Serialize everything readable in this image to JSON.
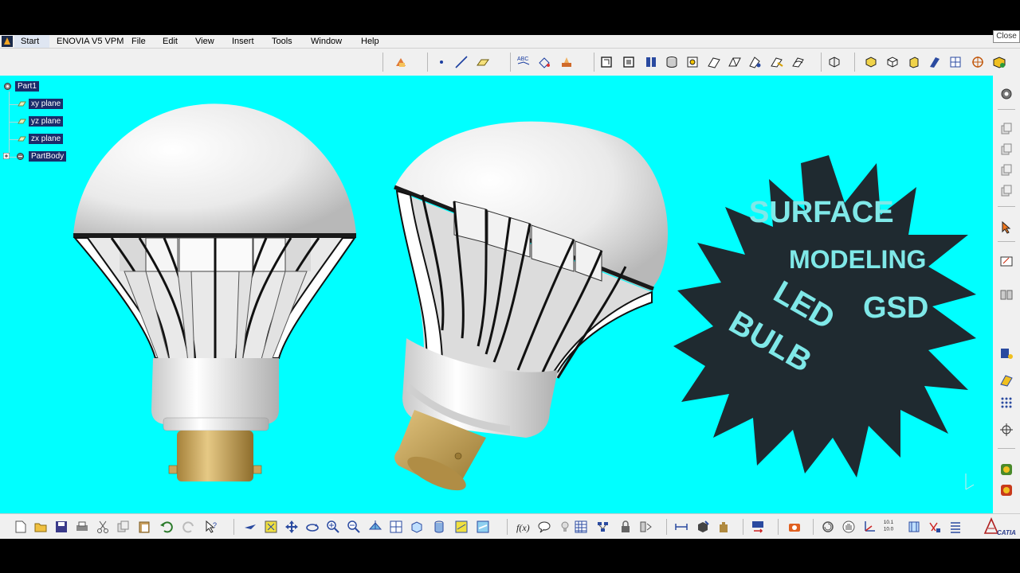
{
  "app": {
    "start_label": "Start",
    "menu": [
      "ENOVIA V5 VPM",
      "File",
      "Edit",
      "View",
      "Insert",
      "Tools",
      "Window",
      "Help"
    ],
    "close_label": "Close"
  },
  "tree": {
    "root": "Part1",
    "planes": [
      "xy plane",
      "yz plane",
      "zx plane"
    ],
    "body": "PartBody"
  },
  "overlay": {
    "line1": "SURFACE",
    "line2": "MODELING",
    "line3": "GSD",
    "line4": "LED",
    "line5": "BULB"
  },
  "colors": {
    "viewport_bg": "#00ffff",
    "starburst": "#1f2a30",
    "overlay_text": "#7fe8e8",
    "bulb_dome": "#f2f2f2",
    "brass_cap": "#c9a55c",
    "tree_label_bg": "#1a2c6b"
  },
  "icons": {
    "top": [
      "sketcher-icon",
      "point-icon",
      "line-icon",
      "plane-icon",
      "text-icon",
      "measure-icon",
      "analysis-icon",
      "extrude-icon",
      "revolve-icon",
      "sphere-icon",
      "cylinder-icon",
      "offset-icon",
      "sweep-icon",
      "fill-icon",
      "multisection-icon",
      "blend-icon",
      "join-icon",
      "healing-icon",
      "split-icon",
      "trim-icon",
      "boundary-icon",
      "extract-icon",
      "fillet-icon",
      "transform-icon",
      "extrapolate-icon",
      "axis-icon",
      "render-icon"
    ],
    "bottom": [
      "new-icon",
      "open-icon",
      "save-icon",
      "print-icon",
      "cut-icon",
      "copy-icon",
      "paste-icon",
      "undo-icon",
      "redo-icon",
      "whats-this-icon",
      "fly-icon",
      "fit-all-icon",
      "pan-icon",
      "rotate-icon",
      "zoom-in-icon",
      "zoom-out-icon",
      "normal-view-icon",
      "multi-view-icon",
      "iso-view-icon",
      "shading-icon",
      "hide-show-icon",
      "swap-icon",
      "formula-icon",
      "comment-icon",
      "knowledge-icon",
      "table-icon",
      "params-icon",
      "lock-icon",
      "catalog-icon",
      "measure-between-icon",
      "measure-item-icon",
      "mass-icon",
      "update-icon",
      "photo-icon",
      "swap-visible-icon",
      "hand-icon",
      "axis-system-icon",
      "grid-icon",
      "tube-icon",
      "symbol-icon",
      "list-icon"
    ]
  }
}
